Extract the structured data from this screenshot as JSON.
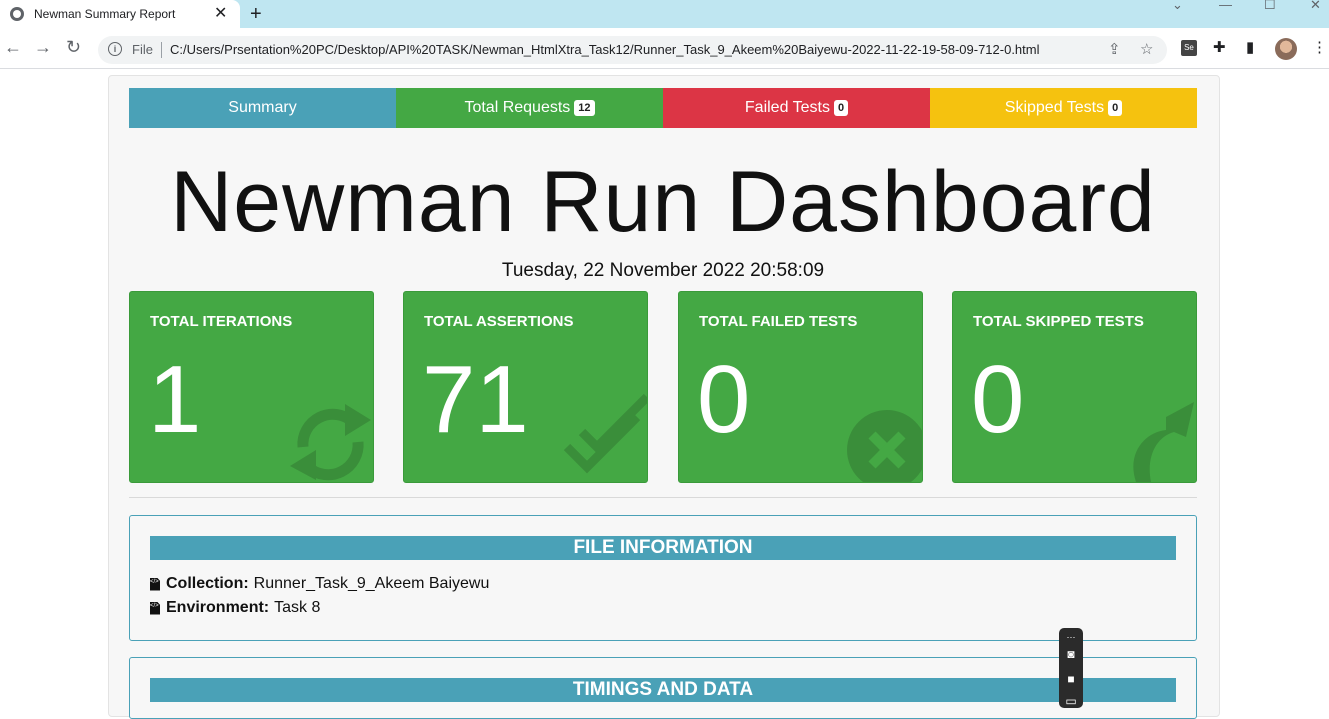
{
  "browser": {
    "tab_title": "Newman Summary Report",
    "tab_close": "✕",
    "new_tab": "+",
    "file_label": "File",
    "url": "C:/Users/Prsentation%20PC/Desktop/API%20TASK/Newman_HtmlXtra_Task12/Runner_Task_9_Akeem%20Baiyewu-2022-11-22-19-58-09-712-0.html"
  },
  "nav": {
    "summary": "Summary",
    "total_requests": "Total Requests",
    "total_requests_count": "12",
    "failed_tests": "Failed Tests",
    "failed_tests_count": "0",
    "skipped_tests": "Skipped Tests",
    "skipped_tests_count": "0",
    "colors": {
      "summary": "#4aa1b7",
      "requests": "#44a844",
      "failed": "#dc3545",
      "skipped": "#f5c20f"
    }
  },
  "dashboard": {
    "title": "Newman Run Dashboard",
    "date": "Tuesday, 22 November 2022 20:58:09"
  },
  "cards": {
    "iterations": {
      "label": "TOTAL ITERATIONS",
      "value": "1",
      "icon": "sync-icon"
    },
    "assertions": {
      "label": "TOTAL ASSERTIONS",
      "value": "71",
      "icon": "check-double-icon"
    },
    "failed": {
      "label": "TOTAL FAILED TESTS",
      "value": "0",
      "icon": "times-circle-icon"
    },
    "skipped": {
      "label": "TOTAL SKIPPED TESTS",
      "value": "0",
      "icon": "share-icon"
    },
    "color": "#44a844"
  },
  "file_info": {
    "heading": "FILE INFORMATION",
    "collection_label": "Collection:",
    "collection_value": "Runner_Task_9_Akeem Baiyewu",
    "environment_label": "Environment:",
    "environment_value": "Task 8"
  },
  "timings": {
    "heading": "TIMINGS AND DATA"
  }
}
